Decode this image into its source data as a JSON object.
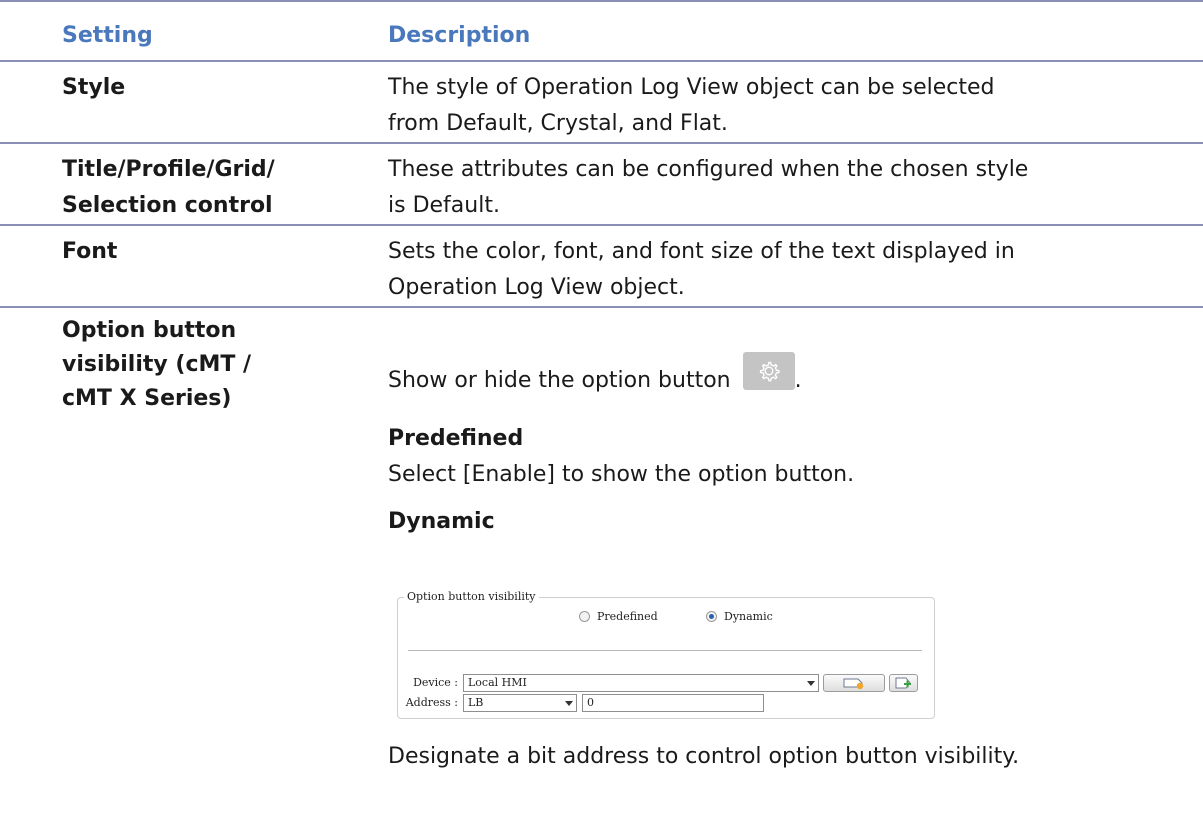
{
  "table": {
    "header": {
      "setting": "Setting",
      "description": "Description"
    },
    "rows": [
      {
        "setting": [
          "Style"
        ],
        "description": [
          "The style of Operation Log View object can be selected",
          "from Default, Crystal, and Flat."
        ]
      },
      {
        "setting": [
          "Title/Profile/Grid/",
          "Selection control"
        ],
        "description": [
          "These attributes can be configured when the chosen style",
          "is Default."
        ]
      },
      {
        "setting": [
          "Font"
        ],
        "description": [
          "Sets the color, font, and font size of the text displayed in",
          "Operation Log View object."
        ]
      },
      {
        "setting": [
          "Option button",
          "visibility (cMT /",
          "cMT X Series)"
        ],
        "description": {
          "intro": "Show or hide the option button",
          "intro_end": ".",
          "predefined_heading": "Predefined",
          "predefined_text": "Select [Enable] to show the option button.",
          "dynamic_heading": "Dynamic",
          "footer": "Designate a bit address to control option button visibility."
        }
      }
    ]
  },
  "dialog": {
    "group_title": "Option button visibility",
    "radio_predefined": "Predefined",
    "radio_dynamic": "Dynamic",
    "selected": "Dynamic",
    "device_label": "Device :",
    "device_value": "Local HMI",
    "address_label": "Address :",
    "address_type": "LB",
    "address_value": "0"
  },
  "icons": {
    "option_button": "gear-icon",
    "settings_button": "tag-settings-icon",
    "add_button": "add-tag-icon"
  },
  "colors": {
    "header_text": "#4a78bd",
    "rule": "#8a8fb6",
    "button_bg": "#c4c4c4"
  }
}
